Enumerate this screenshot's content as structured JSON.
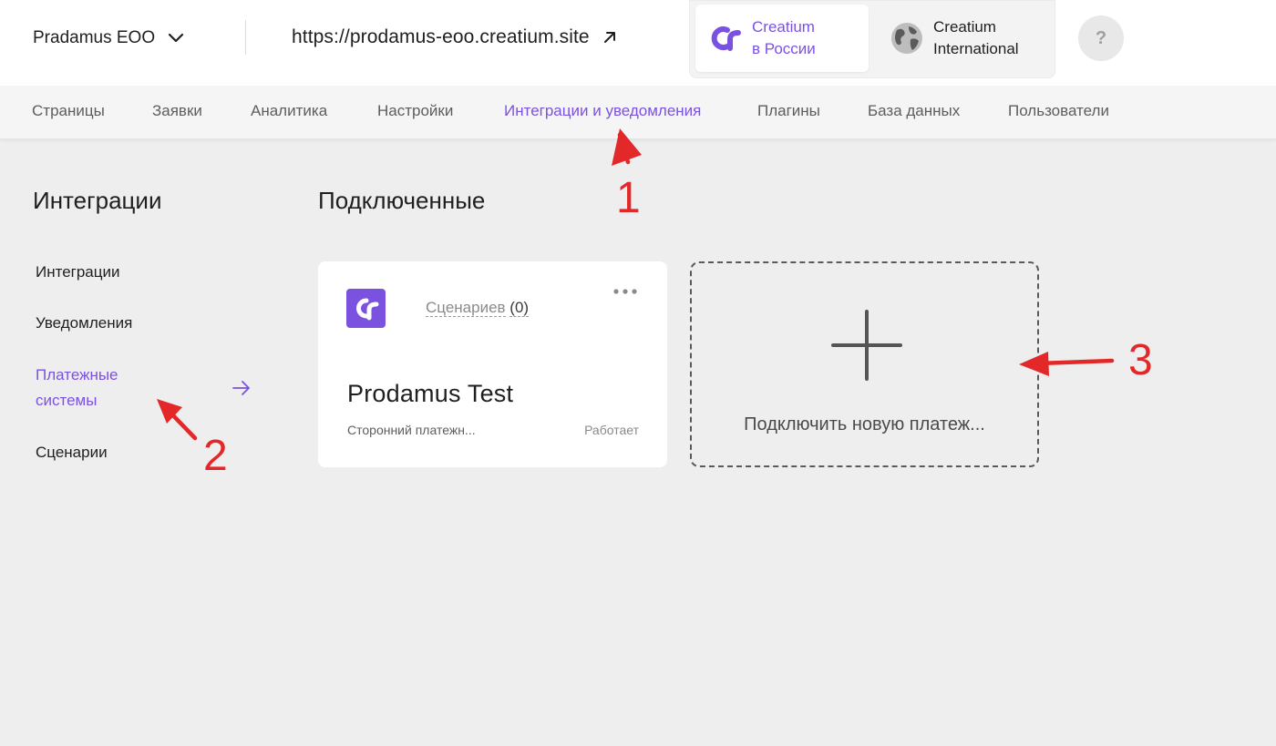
{
  "header": {
    "company_name": "Pradamus EOO",
    "site_url": "https://prodamus-eoo.creatium.site",
    "region_ru": {
      "line1": "Creatium",
      "line2": "в России"
    },
    "region_int": {
      "line1": "Creatium",
      "line2": "International"
    },
    "help_label": "?"
  },
  "nav": {
    "items": [
      {
        "label": "Страницы"
      },
      {
        "label": "Заявки"
      },
      {
        "label": "Аналитика"
      },
      {
        "label": "Настройки"
      },
      {
        "label": "Интеграции и уведомления",
        "active": true
      },
      {
        "label": "Плагины"
      },
      {
        "label": "База данных"
      },
      {
        "label": "Пользователи"
      }
    ]
  },
  "sidebar": {
    "title": "Интеграции",
    "items": [
      {
        "label": "Интеграции"
      },
      {
        "label": "Уведомления"
      },
      {
        "label": "Платежные системы",
        "active": true
      },
      {
        "label": "Сценарии"
      }
    ]
  },
  "main": {
    "title": "Подключенные",
    "card": {
      "scenarios_label": "Сценариев",
      "scenarios_count": "(0)",
      "title": "Prodamus Test",
      "description": "Сторонний платежн...",
      "status": "Работает"
    },
    "add_tile": {
      "label": "Подключить новую платеж..."
    }
  },
  "annotations": {
    "one": "1",
    "two": "2",
    "three": "3"
  },
  "colors": {
    "accent": "#7b52e0",
    "annotation": "#e3282a",
    "background": "#eeeeee"
  },
  "icons": [
    "chevron-down-icon",
    "external-link-icon",
    "creatium-logo",
    "globe-icon",
    "arrow-right-icon",
    "more-dots-icon",
    "plus-icon"
  ]
}
